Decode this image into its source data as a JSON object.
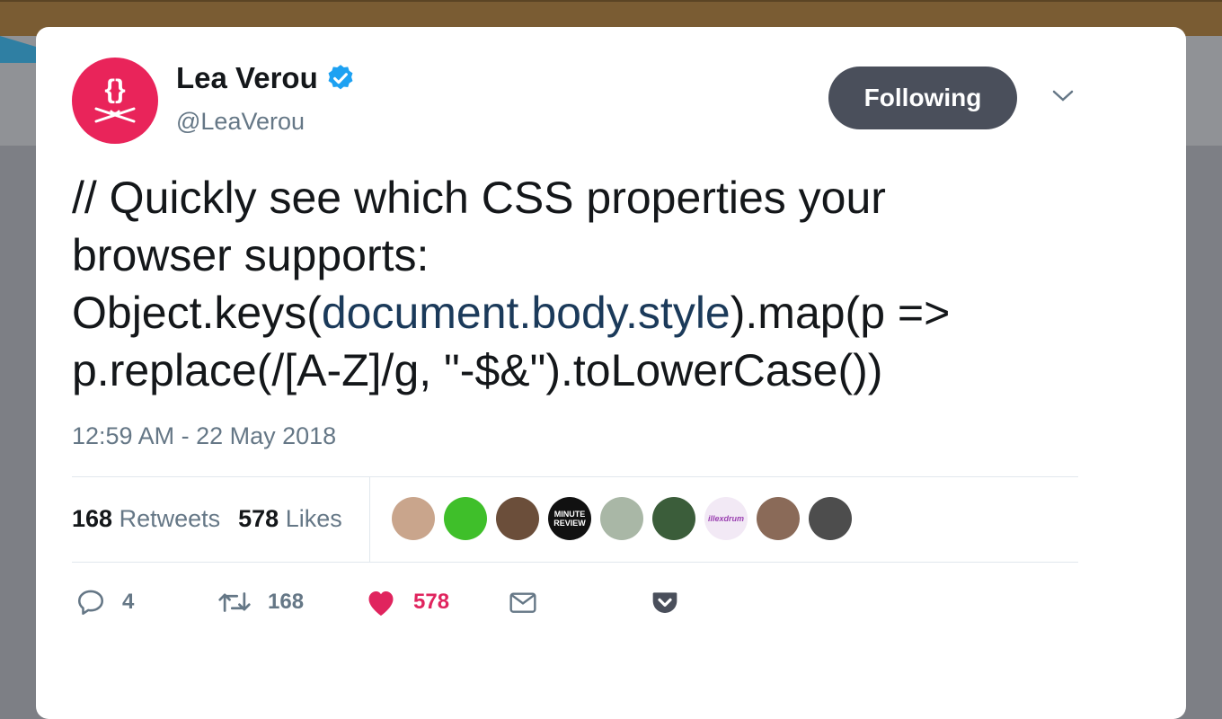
{
  "tweet": {
    "author": {
      "name": "Lea Verou",
      "handle": "@LeaVerou",
      "verified": true,
      "avatar_icon": "curly-braces-swords-icon",
      "avatar_color": "#e9245a"
    },
    "follow_button": "Following",
    "text": {
      "part1": "// Quickly see which CSS properties your\nbrowser supports:\nObject.keys(",
      "link": "document.body.style",
      "part2": ").map(p =>\np.replace(/[A-Z]/g, \"-$&\").toLowerCase())"
    },
    "timestamp": "12:59 AM - 22 May 2018",
    "stats": {
      "retweets_count": "168",
      "retweets_label": "Retweets",
      "likes_count": "578",
      "likes_label": "Likes"
    },
    "likers": [
      {
        "name": "liker-1",
        "color": "#c9a58c"
      },
      {
        "name": "liker-2",
        "color": "#3fbf2a"
      },
      {
        "name": "liker-3",
        "color": "#6b4e3a"
      },
      {
        "name": "liker-4",
        "color": "#111111",
        "label": "MINUTE REVIEW"
      },
      {
        "name": "liker-5",
        "color": "#a9b7a6"
      },
      {
        "name": "liker-6",
        "color": "#3b5d3a"
      },
      {
        "name": "liker-7",
        "color": "#f2e9f5",
        "label": "illexdrum"
      },
      {
        "name": "liker-8",
        "color": "#8a6a58"
      },
      {
        "name": "liker-9",
        "color": "#4d4d4d"
      }
    ],
    "actions": {
      "replies": "4",
      "retweets": "168",
      "likes": "578"
    },
    "colors": {
      "text": "#14171a",
      "muted": "#657786",
      "like": "#e0245e",
      "verified": "#1da1f2",
      "follow_bg": "#4a4f5b"
    }
  }
}
